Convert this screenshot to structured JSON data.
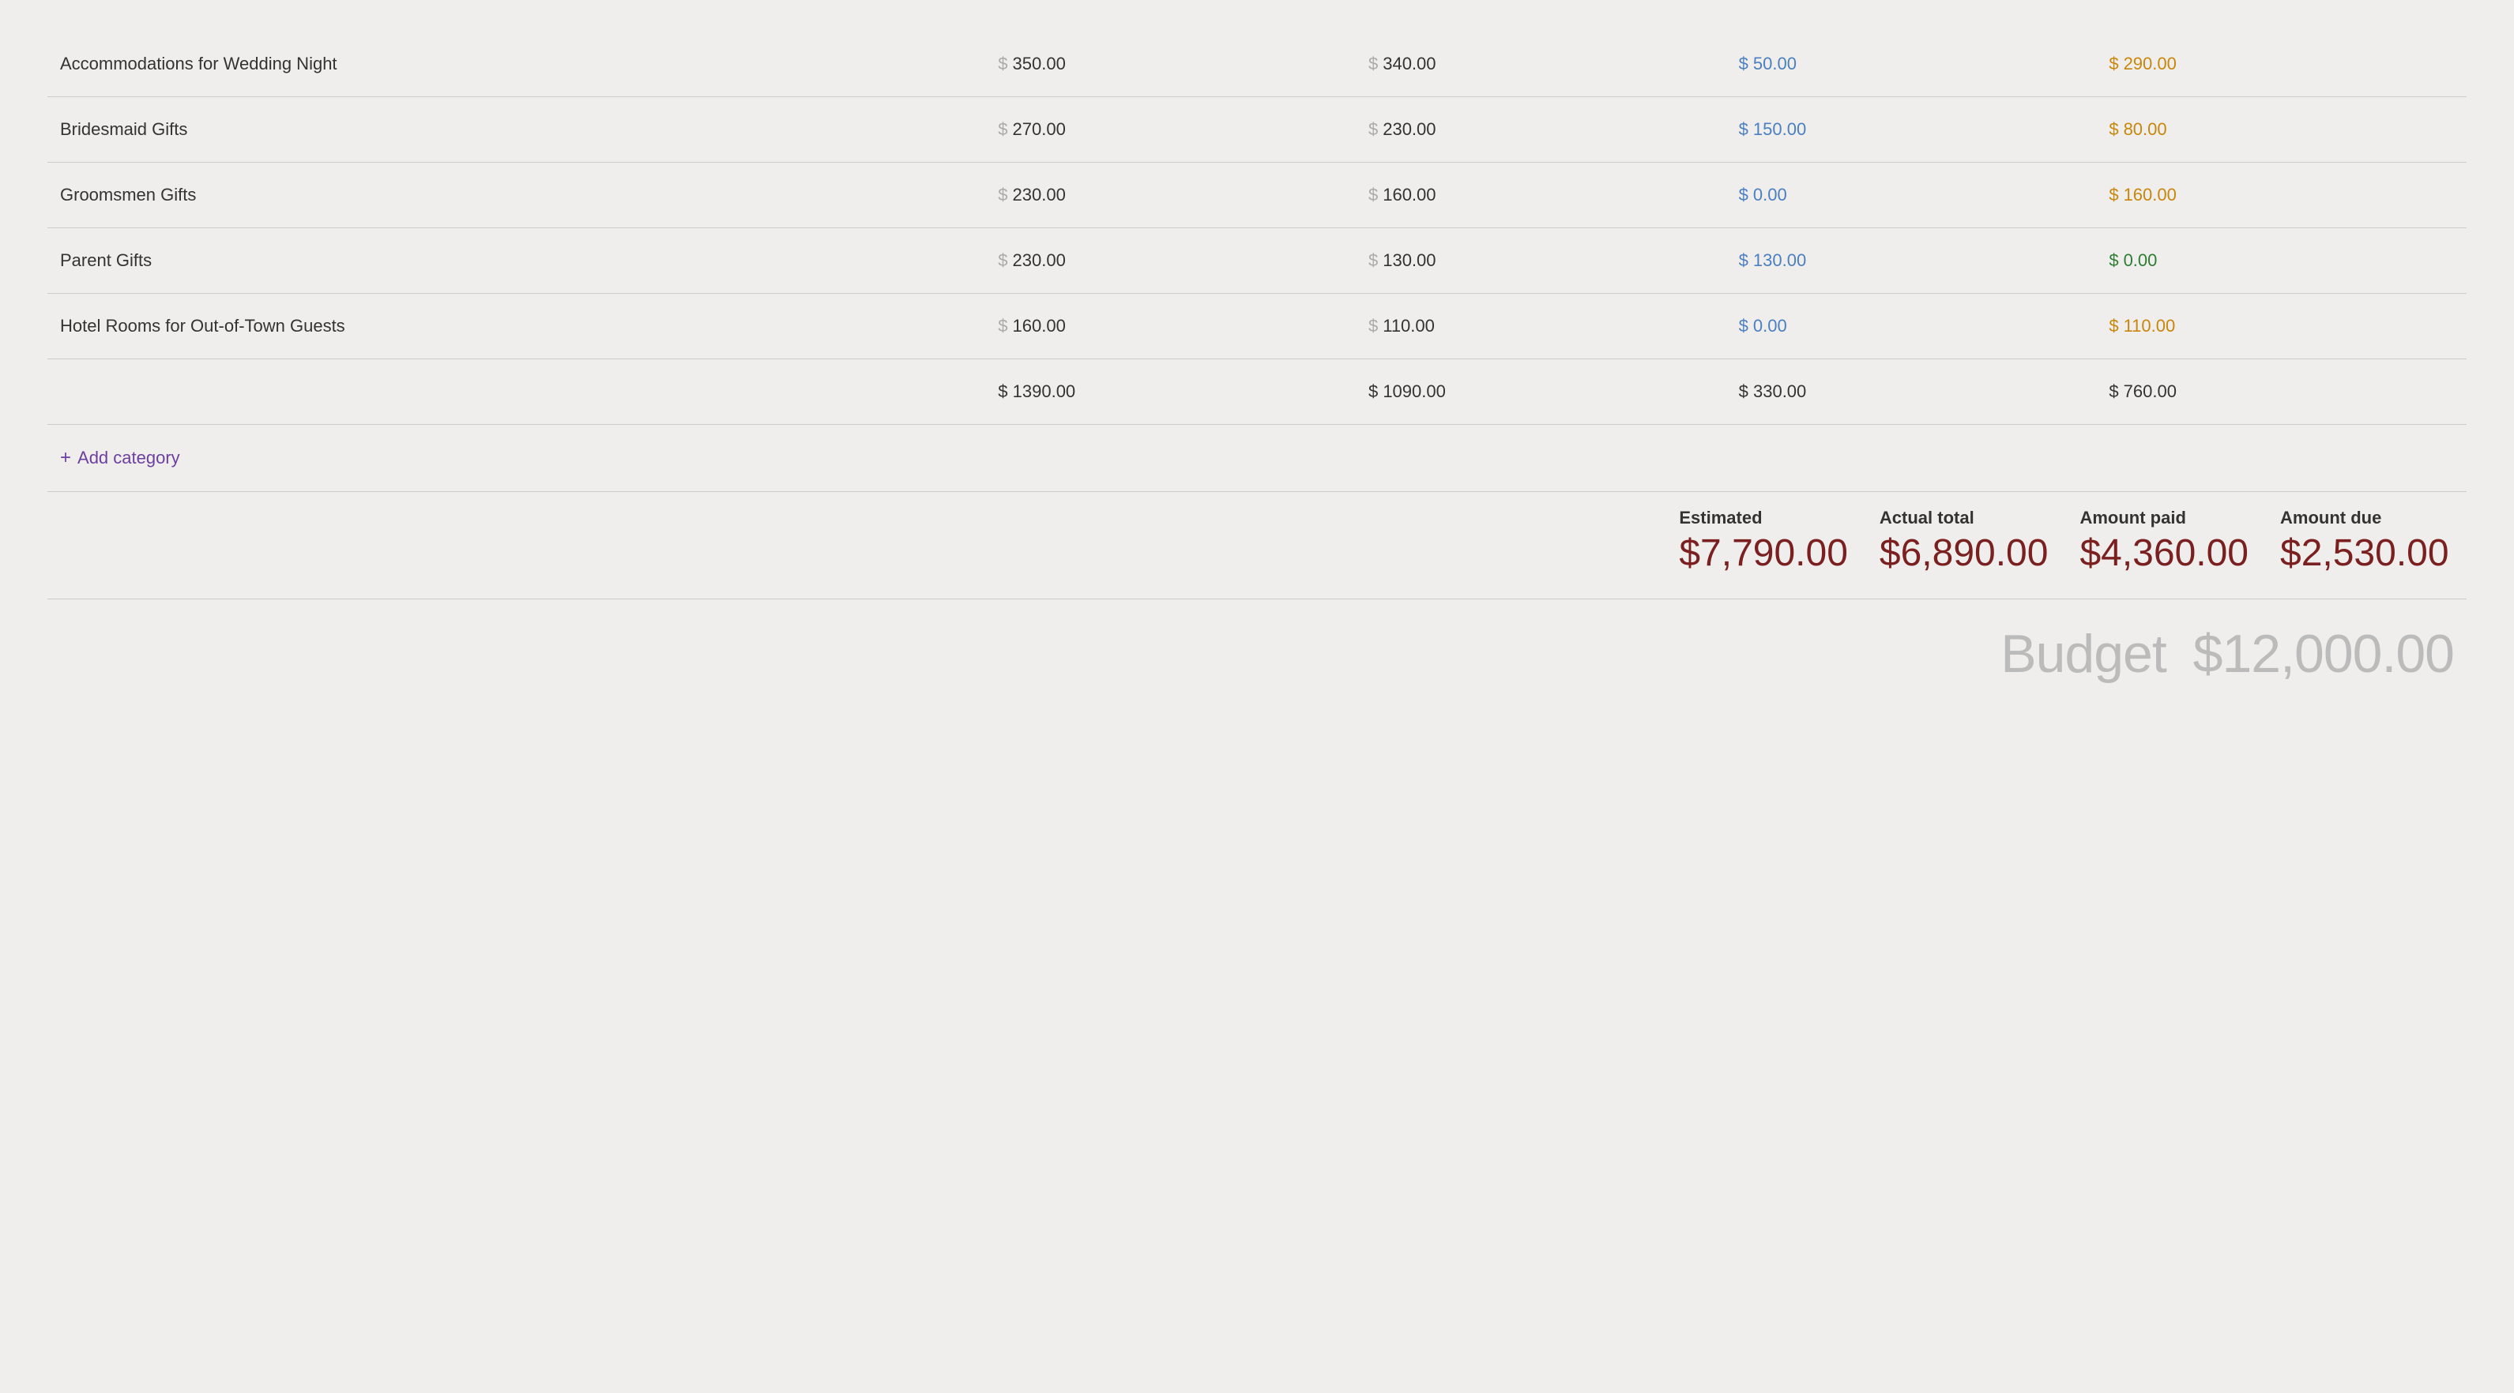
{
  "rows": [
    {
      "name": "Accommodations for Wedding Night",
      "estimated": "350.00",
      "actual": "340.00",
      "paid": "50.00",
      "due": "290.00",
      "due_color": "orange"
    },
    {
      "name": "Bridesmaid Gifts",
      "estimated": "270.00",
      "actual": "230.00",
      "paid": "150.00",
      "due": "80.00",
      "due_color": "orange"
    },
    {
      "name": "Groomsmen Gifts",
      "estimated": "230.00",
      "actual": "160.00",
      "paid": "0.00",
      "due": "160.00",
      "due_color": "orange"
    },
    {
      "name": "Parent Gifts",
      "estimated": "230.00",
      "actual": "130.00",
      "paid": "130.00",
      "due": "0.00",
      "due_color": "green"
    },
    {
      "name": "Hotel Rooms for Out-of-Town Guests",
      "estimated": "160.00",
      "actual": "110.00",
      "paid": "0.00",
      "due": "110.00",
      "due_color": "orange"
    }
  ],
  "subtotal": {
    "estimated": "$ 1390.00",
    "actual": "$ 1090.00",
    "paid": "$ 330.00",
    "due": "$ 760.00"
  },
  "add_category_label": "Add category",
  "summary": {
    "estimated_label": "Estimated",
    "estimated_value": "$7,790.00",
    "actual_label": "Actual total",
    "actual_value": "$6,890.00",
    "paid_label": "Amount paid",
    "paid_value": "$4,360.00",
    "due_label": "Amount due",
    "due_value": "$2,530.00"
  },
  "budget_label": "Budget",
  "budget_value": "$12,000.00",
  "colors": {
    "paid": "#4a7fc1",
    "due_orange": "#c8860a",
    "due_green": "#2e7d32",
    "add_category": "#6b3fa0",
    "summary_value": "#7a2020",
    "budget_total": "#bbb"
  }
}
